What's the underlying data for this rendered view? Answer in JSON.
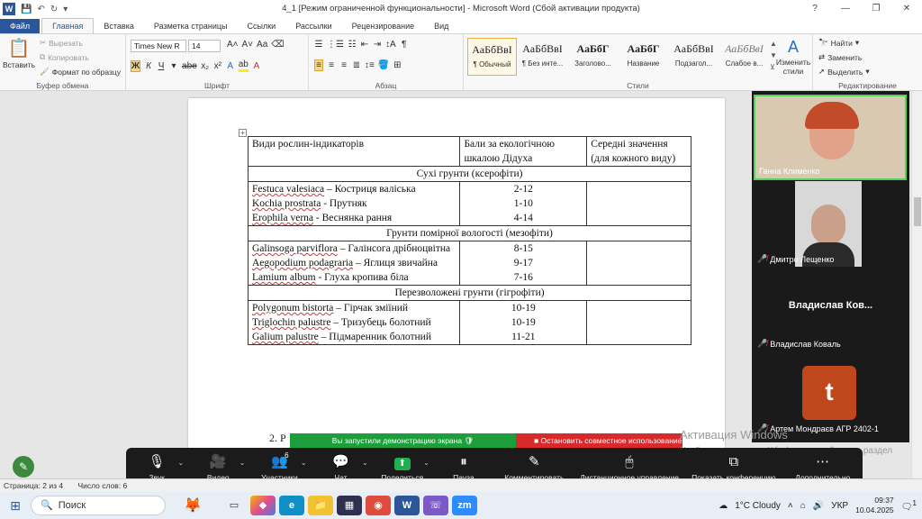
{
  "window": {
    "title": "4_1 [Режим ограниченной функциональности]  -  Microsoft Word (Сбой активации продукта)",
    "controls": [
      "?",
      "—",
      "❐",
      "✕"
    ]
  },
  "tabs": [
    "Файл",
    "Главная",
    "Вставка",
    "Разметка страницы",
    "Ссылки",
    "Рассылки",
    "Рецензирование",
    "Вид"
  ],
  "ribbon": {
    "clipboard": {
      "paste": "Вставить",
      "cut": "Вырезать",
      "copy": "Копировать",
      "format_painter": "Формат по образцу",
      "label": "Буфер обмена"
    },
    "font": {
      "name": "Times New R",
      "size": "14",
      "label": "Шрифт"
    },
    "paragraph": {
      "label": "Абзац"
    },
    "styles": {
      "items": [
        {
          "preview": "АаБбВвІ",
          "label": "¶ Обычный"
        },
        {
          "preview": "АаБбВвІ",
          "label": "¶ Без инте..."
        },
        {
          "preview": "АаБбГ",
          "label": "Заголово..."
        },
        {
          "preview": "АаБбГ",
          "label": "Название"
        },
        {
          "preview": "АаБбВвІ",
          "label": "Подзагол..."
        },
        {
          "preview": "АаБбВвІ",
          "label": "Слабое в..."
        }
      ],
      "change": "Изменить стили",
      "label": "Стили"
    },
    "editing": {
      "find": "Найти",
      "replace": "Заменить",
      "select": "Выделить",
      "label": "Редактирование"
    }
  },
  "document": {
    "header": {
      "col1": "Види рослин-індикаторів",
      "col2": "Бали за екологічною шкалою Дідуха",
      "col3": "Середні значення (для кожного виду)"
    },
    "sections": [
      {
        "title": "Сухі грунти (ксерофіти)",
        "species": [
          {
            "latin": "Festuca valesiaca",
            "rest": " – Костриця  валіська"
          },
          {
            "latin": "Kochia prostrata",
            "rest": " - Прутняк"
          },
          {
            "latin": "Erophila verna",
            "rest": "  - Веснянка  рання"
          }
        ],
        "scores": [
          "2-12",
          "1-10",
          "4-14"
        ]
      },
      {
        "title": "Грунти помірної вологості (мезофіти)",
        "species": [
          {
            "latin": "Galinsoga parviflora",
            "rest": " – Галінсога дрібноцвітна"
          },
          {
            "latin": "Aegopodium podagraria",
            "rest": " – Яглиця звичайна"
          },
          {
            "latin": "Lamium album",
            "rest": "  - Глуха кропива біла"
          }
        ],
        "scores": [
          "8-15",
          "9-17",
          "7-16"
        ]
      },
      {
        "title": "Перезволожені грунти (гігрофіти)",
        "species": [
          {
            "latin": "Polygonum bistorta",
            "rest": " – Гірчак зміїний"
          },
          {
            "latin": "Triglochin palustre",
            "rest": " – Тризубець болотний"
          },
          {
            "latin": "Galium palustre",
            "rest": " – Підмаренник болотний"
          }
        ],
        "scores": [
          "10-19",
          "10-19",
          "11-21"
        ]
      }
    ],
    "list_start": "2.  Р"
  },
  "participants": [
    {
      "name": "Ганна Клименко"
    },
    {
      "name": "Дмитро Лещенко"
    },
    {
      "name": "Владислав Ков...",
      "caption": "Владислав Коваль"
    },
    {
      "name": "Артем Мондраєв АГР 2402-1",
      "initial": "t"
    }
  ],
  "sharing": {
    "banner": "Вы запустили демонстрацию экрана",
    "stop": "Остановить совместное использование"
  },
  "watermark": {
    "line1": "Активация Windows",
    "line2": "Чтобы активировать Windows, перейдите в раздел \"Параметры\"."
  },
  "zoombar": [
    {
      "icon": "🎙",
      "label": "Звук"
    },
    {
      "icon": "🎥",
      "label": "Видео"
    },
    {
      "icon": "👥",
      "label": "Участники",
      "count": "6"
    },
    {
      "icon": "💬",
      "label": "Чат"
    },
    {
      "icon": "⬆",
      "label": "Поделиться"
    },
    {
      "icon": "⏸",
      "label": "Пауза"
    },
    {
      "icon": "✎",
      "label": "Комментировать"
    },
    {
      "icon": "🖱",
      "label": "Дистанционное управление"
    },
    {
      "icon": "⧉",
      "label": "Показать конференцию"
    },
    {
      "icon": "⋯",
      "label": "Дополнительно"
    }
  ],
  "statusbar": {
    "page": "Страница: 2 из 4",
    "words": "Число слов: 6"
  },
  "taskbar": {
    "search": "Поиск",
    "weather": "1°C  Cloudy",
    "lang": "УКР",
    "time": "09:37",
    "date": "10.04.2025",
    "notifications": "1"
  }
}
